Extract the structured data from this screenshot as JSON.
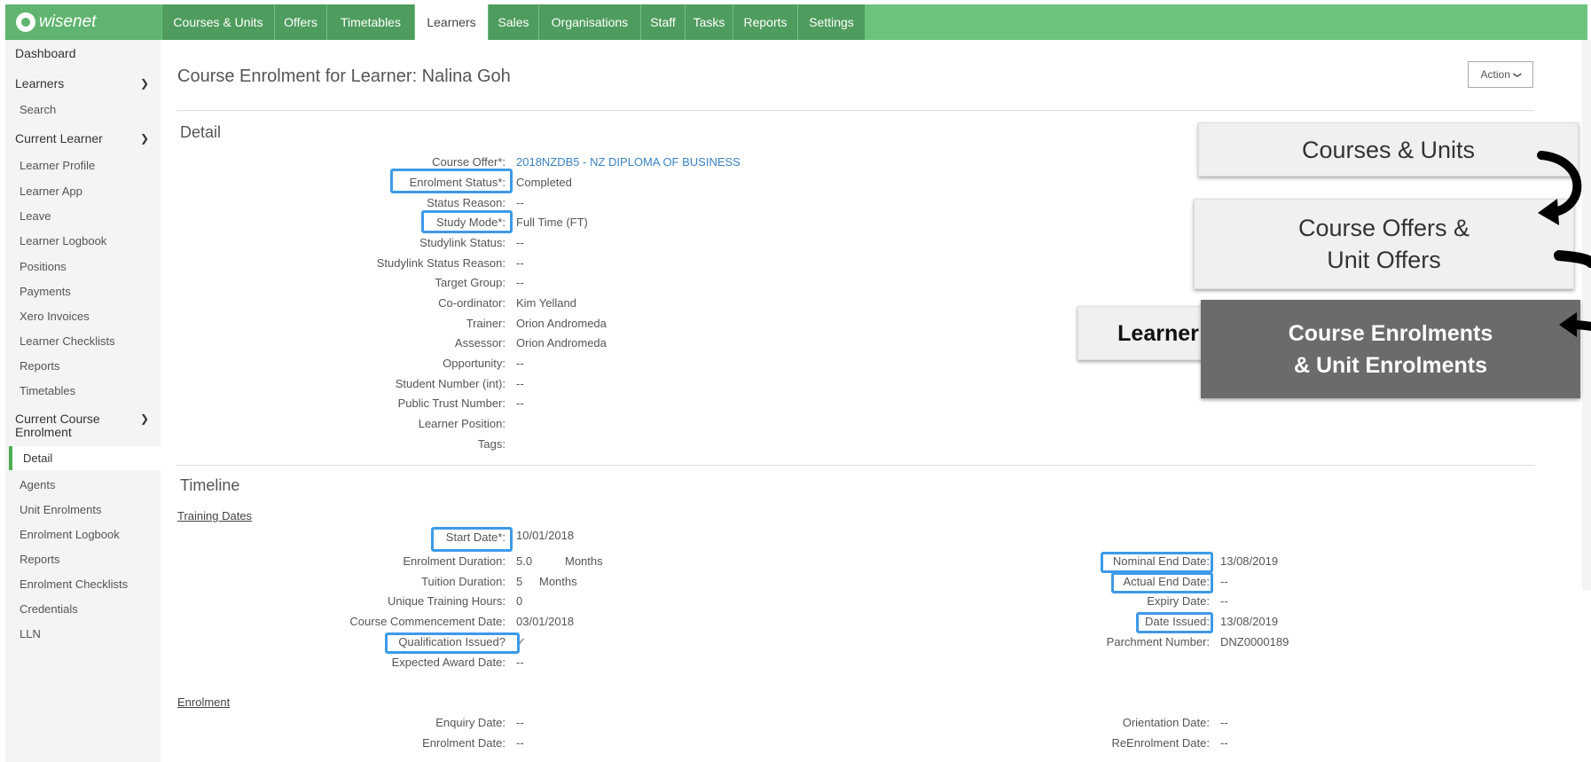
{
  "logo": {
    "text": "wisenet"
  },
  "tabs": [
    {
      "label": "Courses & Units"
    },
    {
      "label": "Offers"
    },
    {
      "label": "Timetables"
    },
    {
      "label": "Learners"
    },
    {
      "label": "Sales"
    },
    {
      "label": "Organisations"
    },
    {
      "label": "Staff"
    },
    {
      "label": "Tasks"
    },
    {
      "label": "Reports"
    },
    {
      "label": "Settings"
    }
  ],
  "sidebar": {
    "dashboard": "Dashboard",
    "learners": "Learners",
    "learners_items": [
      "Search"
    ],
    "current_learner": "Current Learner",
    "current_learner_items": [
      "Learner Profile",
      "Learner App",
      "Leave",
      "Learner Logbook",
      "Positions",
      "Payments",
      "Xero Invoices",
      "Learner Checklists",
      "Reports",
      "Timetables"
    ],
    "current_course_enrolment": "Current Course Enrolment",
    "enrolment_items": [
      "Detail",
      "Agents",
      "Unit Enrolments",
      "Enrolment Logbook",
      "Reports",
      "Enrolment Checklists",
      "Credentials",
      "LLN"
    ]
  },
  "page": {
    "title": "Course Enrolment for Learner: Nalina Goh",
    "action_label": "Action"
  },
  "detail": {
    "title": "Detail",
    "fields": [
      {
        "label": "Course Offer*:",
        "value": "2018NZDB5 - NZ DIPLOMA OF BUSINESS"
      },
      {
        "label": "Enrolment Status*:",
        "value": "Completed"
      },
      {
        "label": "Status Reason:",
        "value": "--"
      },
      {
        "label": "Study Mode*:",
        "value": "Full Time (FT)"
      },
      {
        "label": "Studylink Status:",
        "value": "--"
      },
      {
        "label": "Studylink Status Reason:",
        "value": "--"
      },
      {
        "label": "Target Group:",
        "value": "--"
      },
      {
        "label": "Co-ordinator:",
        "value": "Kim Yelland"
      },
      {
        "label": "Trainer:",
        "value": "Orion Andromeda"
      },
      {
        "label": "Assessor:",
        "value": "Orion Andromeda"
      },
      {
        "label": "Opportunity:",
        "value": "--"
      },
      {
        "label": "Student Number (int):",
        "value": "--"
      },
      {
        "label": "Public Trust Number:",
        "value": "--"
      },
      {
        "label": "Learner Position:",
        "value": ""
      },
      {
        "label": "Tags:",
        "value": ""
      }
    ]
  },
  "timeline": {
    "title": "Timeline",
    "training_dates_title": "Training Dates",
    "left": [
      {
        "label": "Start Date*:",
        "value": "10/01/2018"
      },
      {
        "label": "Enrolment Duration:",
        "value": "5.0",
        "unit": "Months"
      },
      {
        "label": "Tuition Duration:",
        "value": "5",
        "unit": "Months"
      },
      {
        "label": "Unique Training Hours:",
        "value": "0"
      },
      {
        "label": "Course Commencement Date:",
        "value": "03/01/2018"
      },
      {
        "label": "Qualification Issued?",
        "value": "✔"
      },
      {
        "label": "Expected Award Date:",
        "value": "--"
      }
    ],
    "right": [
      {
        "label": "Nominal End Date:",
        "value": "13/08/2019"
      },
      {
        "label": "Actual End Date:",
        "value": "--"
      },
      {
        "label": "Expiry Date:",
        "value": "--"
      },
      {
        "label": "Date Issued:",
        "value": "13/08/2019"
      },
      {
        "label": "Parchment Number:",
        "value": "DNZ0000189"
      }
    ],
    "enrolment_title": "Enrolment",
    "enrolment_left": [
      {
        "label": "Enquiry Date:",
        "value": "--"
      },
      {
        "label": "Enrolment Date:",
        "value": "--"
      }
    ],
    "enrolment_right": [
      {
        "label": "Orientation Date:",
        "value": "--"
      },
      {
        "label": "ReEnrolment Date:",
        "value": "--"
      }
    ]
  },
  "callouts": {
    "courses_units": "Courses & Units",
    "course_offers_line1": "Course Offers &",
    "course_offers_line2": "Unit Offers",
    "learner": "Learner",
    "course_enrolments_line1": "Course Enrolments",
    "course_enrolments_line2": "& Unit Enrolments"
  },
  "colors": {
    "nav_green": "#6cc37c",
    "nav_tab": "#4e9c5e",
    "highlight": "#3d9ae8",
    "link": "#3b82c4"
  }
}
